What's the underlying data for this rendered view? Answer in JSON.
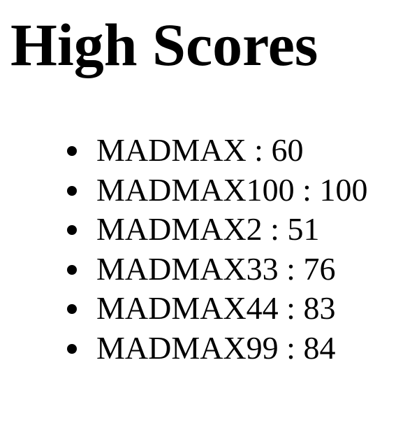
{
  "page": {
    "title": "High Scores"
  },
  "scores": [
    {
      "name": "MADMAX",
      "score": "60",
      "text": "MADMAX : 60"
    },
    {
      "name": "MADMAX100",
      "score": "100",
      "text": "MADMAX100 : 100"
    },
    {
      "name": "MADMAX2",
      "score": "51",
      "text": "MADMAX2 : 51"
    },
    {
      "name": "MADMAX33",
      "score": "76",
      "text": "MADMAX33 : 76"
    },
    {
      "name": "MADMAX44",
      "score": "83",
      "text": "MADMAX44 : 83"
    },
    {
      "name": "MADMAX99",
      "score": "84",
      "text": "MADMAX99 : 84"
    }
  ]
}
